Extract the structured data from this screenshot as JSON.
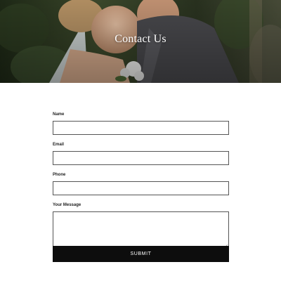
{
  "hero": {
    "title": "Contact Us",
    "image_subject": "wedding-couple-photo"
  },
  "form": {
    "fields": [
      {
        "label": "Name",
        "value": "",
        "placeholder": ""
      },
      {
        "label": "Email",
        "value": "",
        "placeholder": ""
      },
      {
        "label": "Phone",
        "value": "",
        "placeholder": ""
      }
    ],
    "message": {
      "label": "Your Message",
      "value": "",
      "placeholder": ""
    },
    "submit_label": "SUBMIT"
  },
  "colors": {
    "button_bg": "#0d0d0d",
    "button_text": "#ffffff",
    "input_border": "#555555",
    "hero_text": "#ffffff"
  }
}
